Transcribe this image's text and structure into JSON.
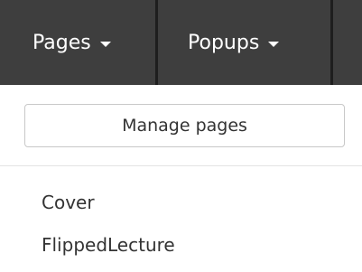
{
  "nav": {
    "tabs": [
      {
        "label": "Pages"
      },
      {
        "label": "Popups"
      }
    ]
  },
  "manage_button": {
    "label": "Manage pages"
  },
  "pages": [
    {
      "label": "Cover"
    },
    {
      "label": "FlippedLecture"
    }
  ],
  "colors": {
    "topbar_bg": "#3e3e3e",
    "tab_separator": "#1e1e1e",
    "text": "#333333",
    "button_border": "#c8c8c8"
  },
  "icons": {
    "dropdown": "caret-down-icon"
  }
}
